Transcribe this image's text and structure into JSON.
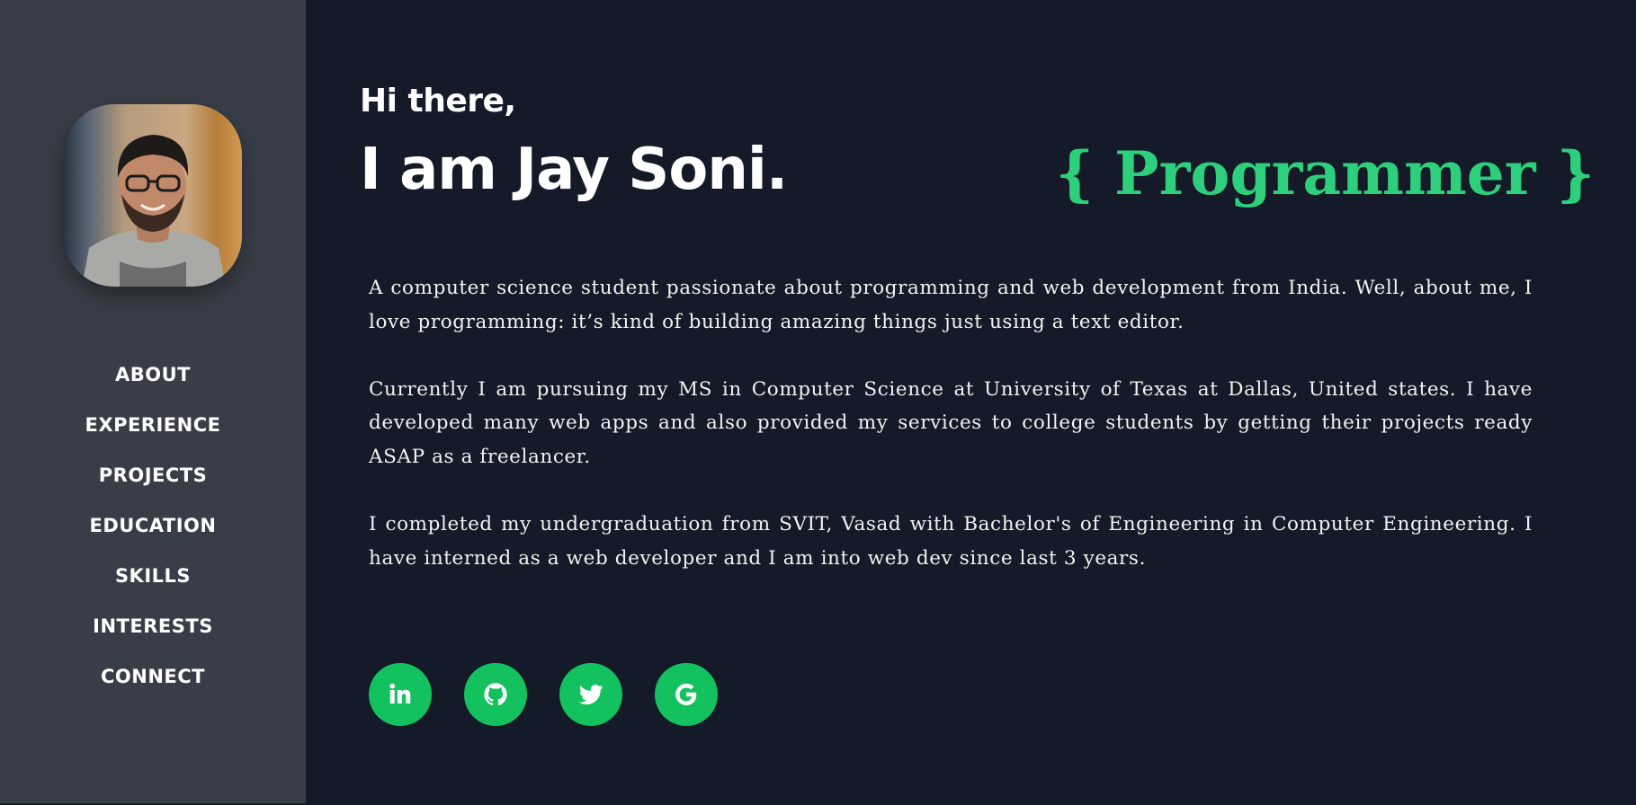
{
  "profile": {
    "avatar_alt": "avatar"
  },
  "nav": {
    "items": [
      {
        "label": "ABOUT"
      },
      {
        "label": "EXPERIENCE"
      },
      {
        "label": "PROJECTS"
      },
      {
        "label": "EDUCATION"
      },
      {
        "label": "SKILLS"
      },
      {
        "label": "INTERESTS"
      },
      {
        "label": "CONNECT"
      }
    ]
  },
  "hero": {
    "greeting": "Hi there,",
    "name": "I am Jay Soni.",
    "role": "{ Programmer }"
  },
  "about": {
    "paragraphs": [
      "A computer science student passionate about programming and web development from India. Well, about me, I love programming: it’s kind of building amazing things just using a text editor.",
      "Currently I am pursuing my MS in Computer Science at University of Texas at Dallas, United states. I have developed many web apps and also provided my services to college students by getting their projects ready ASAP as a freelancer.",
      "I completed my undergraduation from SVIT, Vasad with Bachelor's of Engineering in Computer Engineering. I have interned as a web developer and I am into web dev since last 3 years."
    ]
  },
  "socials": [
    {
      "icon": "linkedin-icon"
    },
    {
      "icon": "github-icon"
    },
    {
      "icon": "twitter-icon"
    },
    {
      "icon": "google-icon"
    }
  ],
  "colors": {
    "sidebar_bg": "#393d47",
    "main_bg": "#141a27",
    "accent": "#2ecf7c",
    "social_bg": "#13c15f",
    "text": "#ffffff"
  }
}
